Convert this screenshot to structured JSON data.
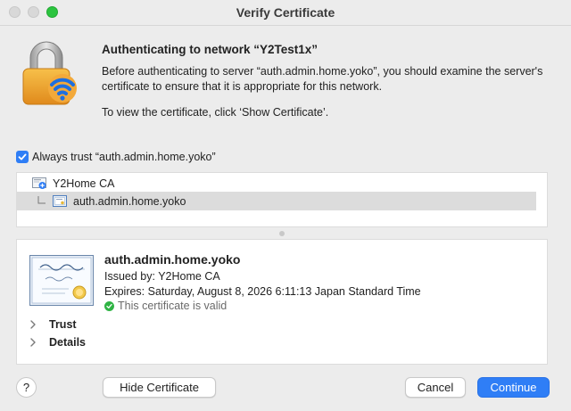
{
  "window": {
    "title": "Verify Certificate"
  },
  "header": {
    "heading": "Authenticating to network “Y2Test1x”",
    "description": "Before authenticating to server “auth.admin.home.yoko”, you should examine the server's certificate to ensure that it is appropriate for this network.",
    "hint": "To view the certificate, click ‘Show Certificate’."
  },
  "trust_checkbox": {
    "label": "Always trust “auth.admin.home.yoko”",
    "checked": true
  },
  "chain": {
    "items": [
      {
        "label": "Y2Home CA",
        "icon": "certificate-authority-icon"
      },
      {
        "label": "auth.admin.home.yoko",
        "icon": "certificate-icon",
        "selected": true
      }
    ]
  },
  "certificate": {
    "image_icon": "certificate-standard-icon",
    "name": "auth.admin.home.yoko",
    "issued_by": "Issued by: Y2Home CA",
    "expires": "Expires: Saturday, August 8, 2026 6:11:13 Japan Standard Time",
    "status": "This certificate is valid",
    "status_color": "#2fb344",
    "sections": [
      {
        "label": "Trust"
      },
      {
        "label": "Details"
      }
    ]
  },
  "buttons": {
    "help": "?",
    "hide_certificate": "Hide Certificate",
    "cancel": "Cancel",
    "continue": "Continue"
  },
  "colors": {
    "accent": "#2f7ef6",
    "window_bg": "#ececec",
    "selection": "#dcdcdc"
  }
}
